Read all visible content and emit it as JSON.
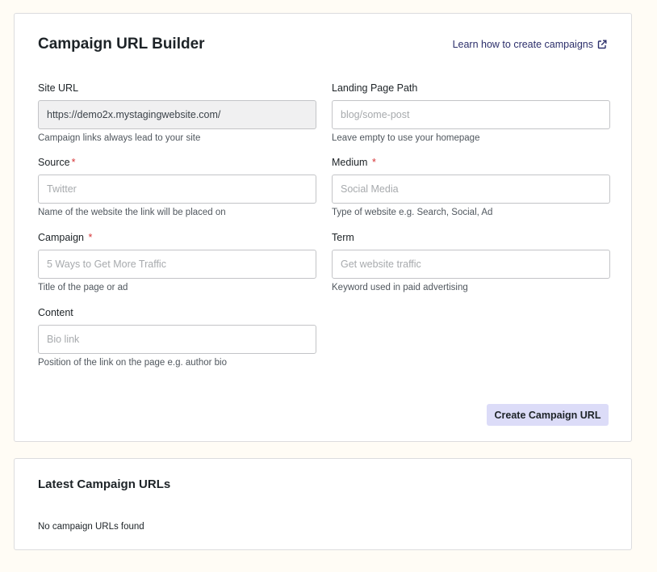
{
  "builder": {
    "title": "Campaign URL Builder",
    "learn_link": "Learn how to create campaigns",
    "learn_icon": "external-link-icon",
    "fields": {
      "site_url": {
        "label": "Site URL",
        "value": "https://demo2x.mystagingwebsite.com/",
        "help": "Campaign links always lead to your site"
      },
      "landing_path": {
        "label": "Landing Page Path",
        "placeholder": "blog/some-post",
        "help": "Leave empty to use your homepage"
      },
      "source": {
        "label": "Source",
        "required": "*",
        "placeholder": "Twitter",
        "help": "Name of the website the link will be placed on"
      },
      "medium": {
        "label": "Medium",
        "required": "*",
        "placeholder": "Social Media",
        "help": "Type of website e.g. Search, Social, Ad"
      },
      "campaign": {
        "label": "Campaign",
        "required": "*",
        "placeholder": "5 Ways to Get More Traffic",
        "help": "Title of the page or ad"
      },
      "term": {
        "label": "Term",
        "placeholder": "Get website traffic",
        "help": "Keyword used in paid advertising"
      },
      "content": {
        "label": "Content",
        "placeholder": "Bio link",
        "help": "Position of the link on the page e.g. author bio"
      }
    },
    "create_button": "Create Campaign URL"
  },
  "latest": {
    "title": "Latest Campaign URLs",
    "empty_text": "No campaign URLs found"
  },
  "colors": {
    "background": "#fffcf5",
    "required": "#d63638",
    "link": "#2c2f6b",
    "button_bg": "#dcdcf8"
  }
}
